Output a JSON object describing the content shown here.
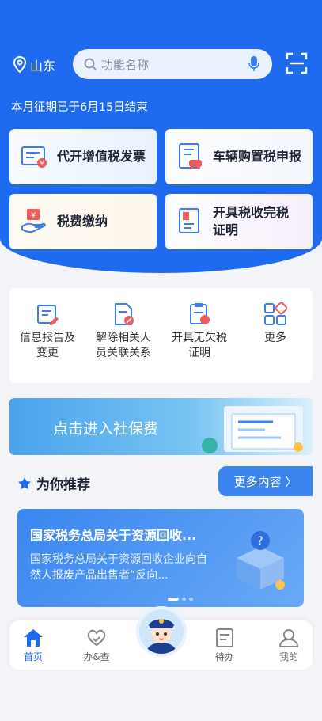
{
  "header": {
    "location": "山东",
    "search_placeholder": "功能名称",
    "notice": "本月征期已于6月15日结束"
  },
  "main_cards": [
    {
      "label": "代开增值税发票",
      "icon": "invoice-icon"
    },
    {
      "label": "车辆购置税申报",
      "icon": "vehicle-tax-icon"
    },
    {
      "label": "税费缴纳",
      "icon": "tax-payment-icon"
    },
    {
      "label": "开具税收完税证明",
      "icon": "tax-certificate-icon"
    }
  ],
  "quick_actions": [
    {
      "label": "信息报告及变更",
      "icon": "info-report-icon"
    },
    {
      "label": "解除相关人员关联关系",
      "icon": "unlink-relation-icon"
    },
    {
      "label": "开具无欠税证明",
      "icon": "no-arrears-icon"
    },
    {
      "label": "更多",
      "icon": "more-grid-icon"
    }
  ],
  "banner": {
    "text": "点击进入社保费"
  },
  "recommend": {
    "title": "为你推荐",
    "more_label": "更多内容 〉",
    "news_title": "国家税务总局关于资源回收...",
    "news_desc": "国家税务总局关于资源回收企业向自然人报废产品出售者“反向..."
  },
  "tabbar": [
    {
      "label": "首页",
      "icon": "home-icon",
      "active": true
    },
    {
      "label": "办&查",
      "icon": "handle-check-icon",
      "active": false
    },
    {
      "label": "待办",
      "icon": "todo-icon",
      "active": false
    },
    {
      "label": "我的",
      "icon": "profile-icon",
      "active": false
    }
  ],
  "colors": {
    "primary": "#1f6bf0",
    "accent_red": "#ef5a5a"
  }
}
